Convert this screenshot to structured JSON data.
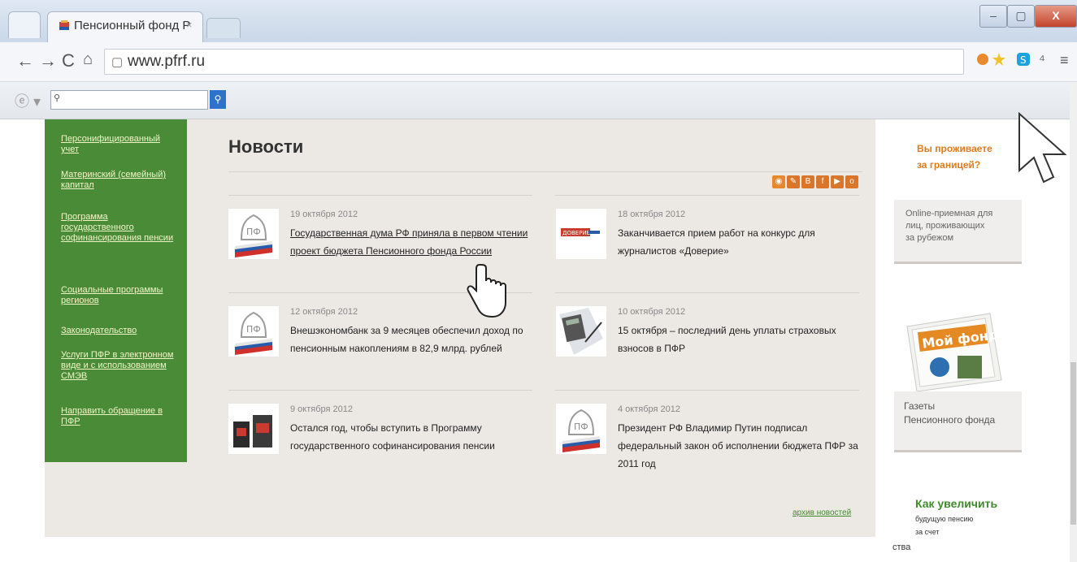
{
  "browser": {
    "tab_title": "Пенсионный фонд Р",
    "tab_close": "×",
    "url": "www.pfrf.ru",
    "window_buttons": {
      "minimize": "–",
      "maximize": "▢",
      "close": "X"
    },
    "nav": {
      "back": "←",
      "forward": "→",
      "reload": "C",
      "home": "⌂"
    },
    "search_icon": "🔍",
    "search_go": "🔍"
  },
  "sidebar": {
    "items": [
      "Персонифицированный учет",
      "Материнский (семейный) капитал",
      "Программа государственного софинансирования пенсии",
      "Социальные программы регионов",
      "Законодательство",
      "Услуги ПФР в электронном виде и с использованием СМЭВ",
      "Направить обращение в ПФР"
    ]
  },
  "news": {
    "title": "Новости",
    "items": [
      {
        "date": "19 октября 2012",
        "headline": "Государственная дума РФ приняла в первом чтении проект бюджета Пенсионного фонда России",
        "thumb": "pfr-logo"
      },
      {
        "date": "18 октября 2012",
        "headline": "Заканчивается прием работ на конкурс для журналистов «Доверие»",
        "thumb": "doverie-logo"
      },
      {
        "date": "12 октября 2012",
        "headline": "Внешэкономбанк за 9 месяцев обеспечил доход по пенсионным накоплениям в 82,9 млрд. рублей",
        "thumb": "pfr-logo"
      },
      {
        "date": "10 октября 2012",
        "headline": "15 октября – последний день уплаты страховых взносов в ПФР",
        "thumb": "calculator-image"
      },
      {
        "date": "9 октября 2012",
        "headline": "Остался год, чтобы вступить в Программу государственного софинансирования пенсии",
        "thumb": "boxes-image"
      },
      {
        "date": "4 октября 2012",
        "headline": "Президент РФ Владимир Путин подписал федеральный закон об исполнении бюджета ПФР за 2011 год",
        "thumb": "pfr-logo"
      }
    ],
    "archive_link": "архив новостей"
  },
  "right_column": {
    "abroad_line1": "Вы проживаете",
    "abroad_line2": "за границей?",
    "reception_line1": "Online-приемная для",
    "reception_line2": "лиц, проживающих",
    "reception_line3": "за рубежом",
    "newspaper_line1": "Газеты",
    "newspaper_line2": "Пенсионного фонда",
    "newspaper_cover": "Мой фонд",
    "increase_title": "Как увеличить",
    "increase_line1": "будущую пенсию",
    "increase_line2": "за счет",
    "increase_line3": "ства"
  },
  "colors": {
    "sidebar_green": "#4a8b38",
    "orange_accent": "#e07a1b",
    "link_green": "#3e8b2c"
  }
}
